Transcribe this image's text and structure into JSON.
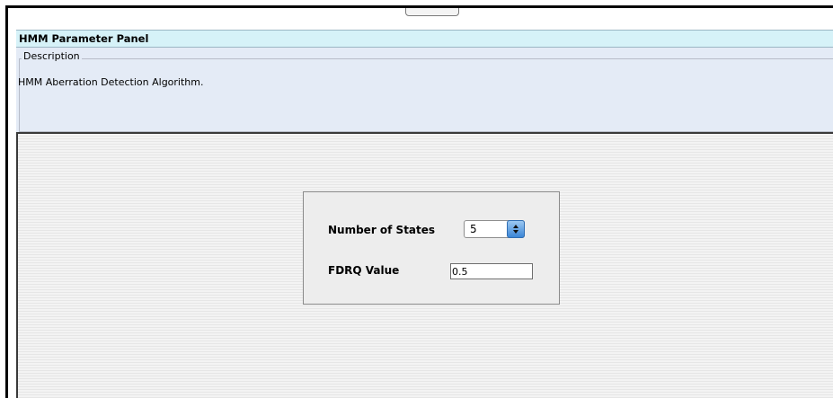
{
  "panel": {
    "title": "HMM Parameter Panel",
    "description_legend": "Description",
    "description_text": "HMM Aberration Detection Algorithm."
  },
  "form": {
    "number_of_states_label": "Number of States",
    "number_of_states_value": "5",
    "fdrq_label": "FDRQ Value",
    "fdrq_value": "0.5"
  },
  "icons": {
    "stepper": "up-down-stepper-icon"
  },
  "colors": {
    "title_bar": "#d6f2f8",
    "description_panel": "#e4ebf6",
    "stepper_button": "#3c86d6"
  }
}
